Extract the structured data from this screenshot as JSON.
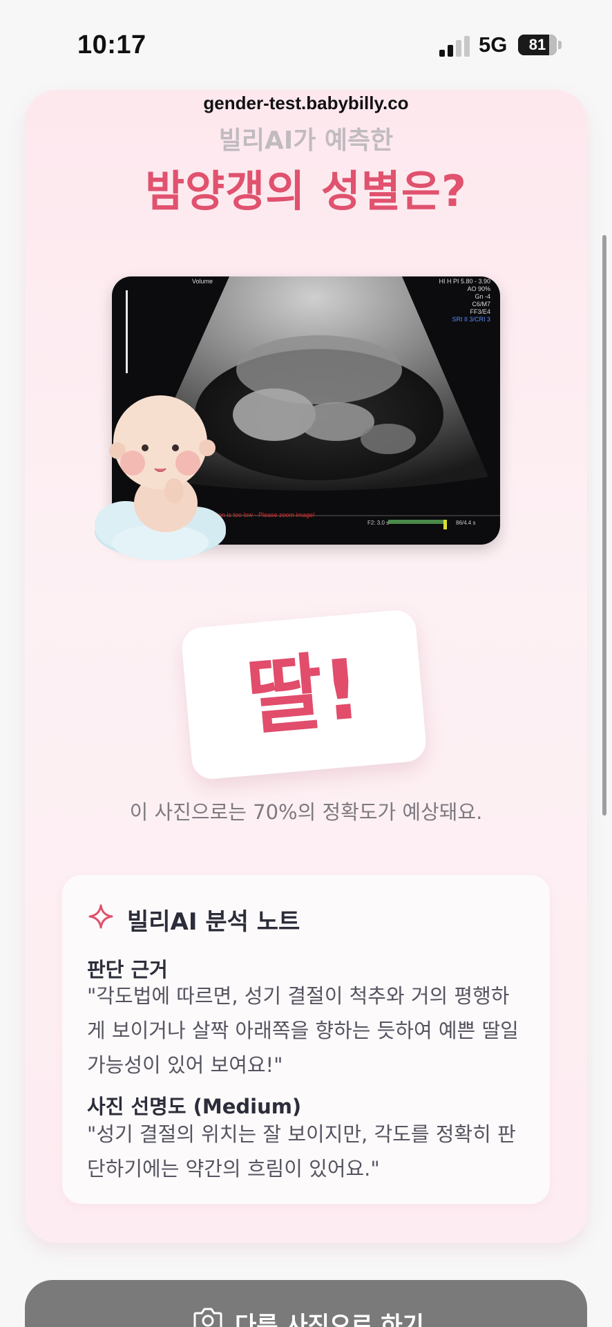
{
  "status_bar": {
    "time": "10:17",
    "network": "5G",
    "battery": "81",
    "battery_level": 0.81
  },
  "url": "gender-test.babybilly.co",
  "header": {
    "subtitle": "빌리AI가 예측한",
    "title": "밤양갱의 성별은?"
  },
  "ultrasound": {
    "overlay_right": [
      "HI H PI 5.80 - 3.90",
      "AO 90%",
      "Gn -4",
      "C6/M7",
      "FF3/E4",
      "SRI II 3/CRI 3"
    ],
    "overlay_left": "Volume",
    "warning": "ion is too low - Please zoom image!",
    "footer_left": "F2: 3.0 s",
    "footer_right": "86/4.4 s"
  },
  "result": {
    "label": "딸!",
    "accuracy_text": "이 사진으로는 70%의 정확도가 예상돼요."
  },
  "note": {
    "title": "빌리AI 분석 노트",
    "sections": [
      {
        "heading": "판단 근거",
        "lines": [
          "\"각도법에 따르면, 성기 결절이 척추와 거의 평행하",
          "게 보이거나 살짝 아래쪽을 향하는 듯하여 예쁜 딸일",
          "가능성이 있어 보여요!\""
        ]
      },
      {
        "heading": "사진 선명도 (Medium)",
        "lines": [
          "\"성기 결절의 위치는 잘 보이지만, 각도를 정확히 판",
          "단하기에는 약간의 흐림이 있어요.\""
        ]
      }
    ]
  },
  "bottom_button": {
    "label": "다른 사진으로 하기"
  },
  "colors": {
    "accent": "#e0526e",
    "card_bg": "#fde8ee",
    "button_bg": "#7a7a7a"
  }
}
